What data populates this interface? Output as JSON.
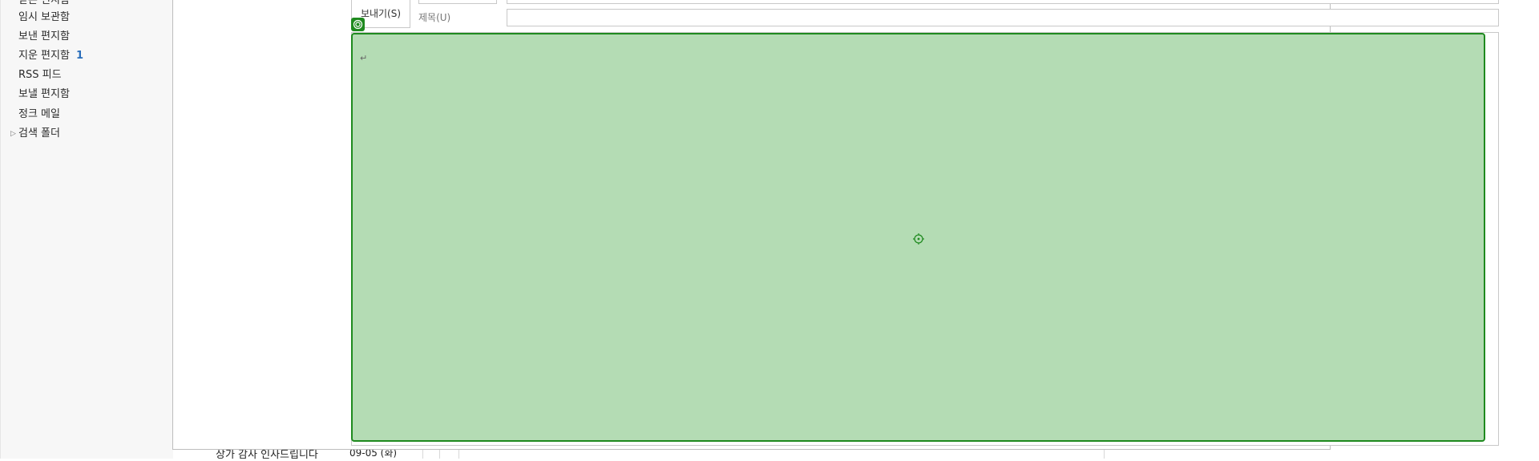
{
  "sidebar": {
    "items": [
      {
        "label": "받은 편지함",
        "count": ""
      },
      {
        "label": "임시 보관함",
        "count": ""
      },
      {
        "label": "보낸 편지함",
        "count": ""
      },
      {
        "label": "지운 편지함",
        "count": "1"
      },
      {
        "label": "RSS 피드",
        "count": ""
      },
      {
        "label": "보낼 편지함",
        "count": ""
      },
      {
        "label": "정크 메일",
        "count": ""
      },
      {
        "label": "검색 폴더",
        "count": ""
      }
    ]
  },
  "background_list": {
    "row_subject": "상가 감사 인사드립니다",
    "row_date": "09-05 (화)"
  },
  "compose": {
    "send_label": "보내기(S)",
    "subject_label": "제목(U)",
    "subject_value": "",
    "paragraph_mark": "↵"
  },
  "colors": {
    "overlay_fill": "#b4dcb4",
    "overlay_border": "#1f8a1f",
    "accent_count": "#2a6ebb"
  },
  "icons": {
    "overlay_badge": "target-icon",
    "crosshair": "crosshair-icon",
    "expander": "triangle-right-icon"
  }
}
